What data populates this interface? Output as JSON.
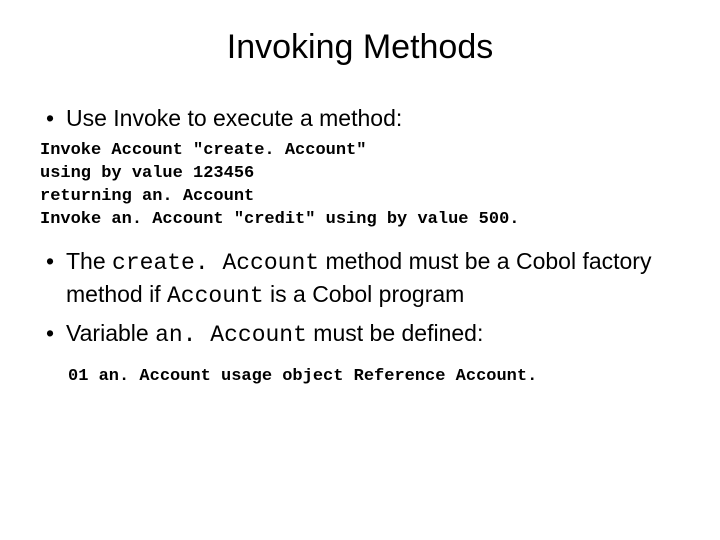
{
  "title": "Invoking Methods",
  "bullets": {
    "b1": "Use Invoke to execute a method:",
    "b2_pre1": "The ",
    "b2_code1": "create. Account",
    "b2_mid1": " method must be a Cobol factory method if ",
    "b2_code2": "Account",
    "b2_post1": " is a Cobol program",
    "b3_pre1": "Variable ",
    "b3_code1": "an. Account",
    "b3_post1": " must be defined:"
  },
  "code1_l1": "Invoke Account \"create. Account\"",
  "code1_l2": "using by value 123456",
  "code1_l3": "returning an. Account",
  "code1_l4": "Invoke an. Account \"credit\" using by value 500.",
  "code2": "01 an. Account usage object Reference Account."
}
